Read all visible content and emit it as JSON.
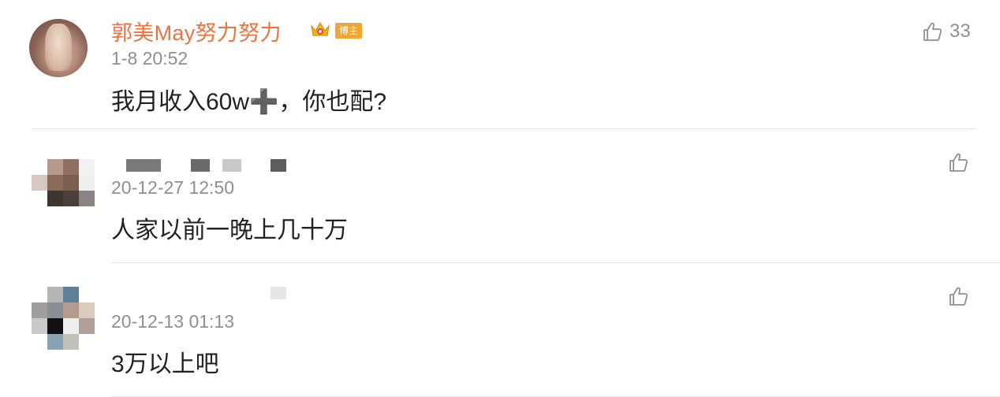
{
  "comments": [
    {
      "username": "郭美May努力努力",
      "badge": "博主",
      "timestamp": "1-8 20:52",
      "text": "我月收入60w➕，你也配?",
      "likes": "33"
    },
    {
      "username": "",
      "timestamp": "20-12-27 12:50",
      "text": "人家以前一晚上几十万",
      "likes": ""
    },
    {
      "username": "",
      "timestamp": "20-12-13 01:13",
      "text": "3万以上吧",
      "likes": ""
    }
  ],
  "colors": {
    "username": "#eb7340",
    "timestamp": "#8f8f8f",
    "text": "#222222",
    "divider": "#e6e6e6",
    "badge": "#f3a531"
  },
  "icons": {
    "like": "thumbs-up-icon",
    "crown": "crown-icon"
  }
}
